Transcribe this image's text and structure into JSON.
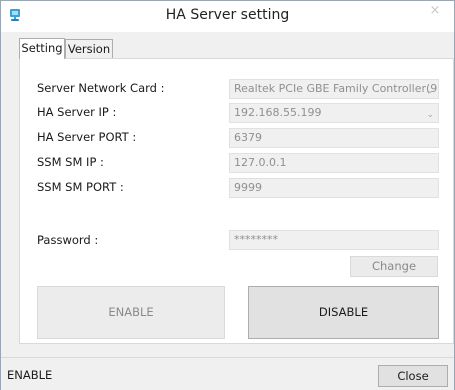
{
  "window": {
    "title": "HA Server setting",
    "close_glyph": "×",
    "app_icon": "network-icon"
  },
  "tabs": [
    {
      "label": "Setting",
      "active": true
    },
    {
      "label": "Version",
      "active": false
    }
  ],
  "form": {
    "network_card": {
      "label": "Server Network Card :",
      "value": "Realtek PCIe GBE Family Controller(9"
    },
    "ha_ip": {
      "label": "HA Server IP :",
      "value": "192.168.55.199"
    },
    "ha_port": {
      "label": "HA Server PORT :",
      "value": "6379"
    },
    "ssm_ip": {
      "label": "SSM SM IP :",
      "value": "127.0.0.1"
    },
    "ssm_port": {
      "label": "SSM SM PORT :",
      "value": "9999"
    },
    "password": {
      "label": "Password :",
      "value": "********"
    }
  },
  "buttons": {
    "change": "Change",
    "enable": "ENABLE",
    "disable": "DISABLE",
    "close": "Close"
  },
  "status": {
    "text": "ENABLE"
  },
  "colors": {
    "disabled_text": "#909090",
    "field_bg": "#f0f0f0",
    "accent": "#1e7fb8"
  }
}
